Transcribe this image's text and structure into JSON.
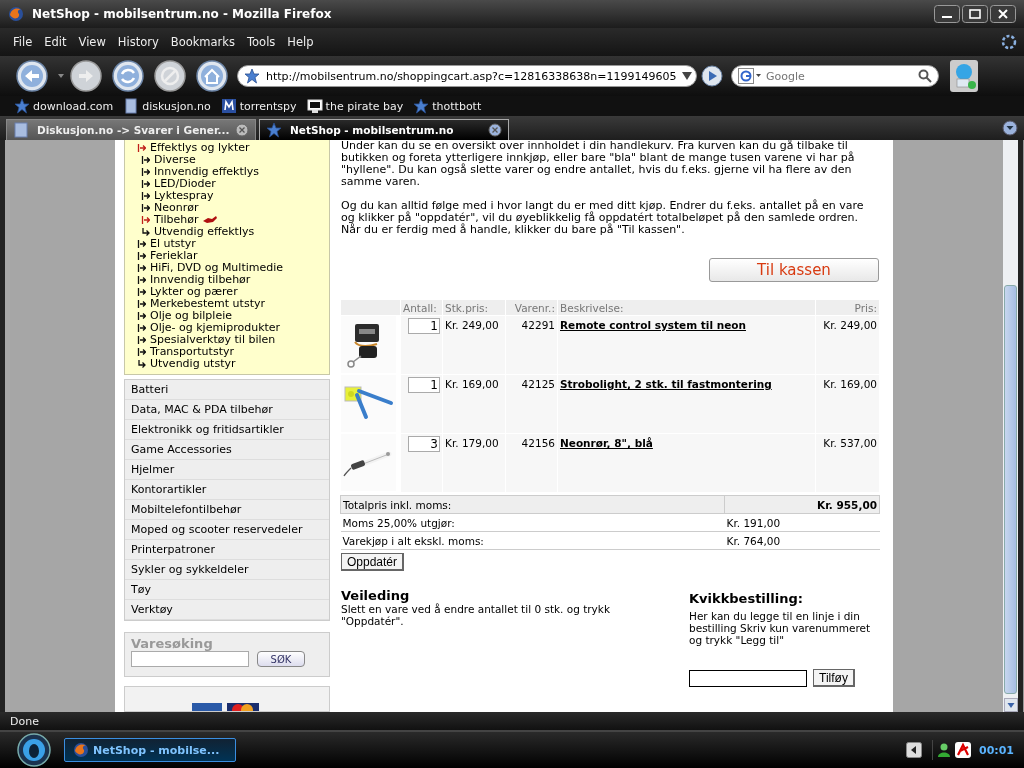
{
  "window": {
    "title": "NetShop - mobilsentrum.no - Mozilla Firefox"
  },
  "menu": [
    "File",
    "Edit",
    "View",
    "History",
    "Bookmarks",
    "Tools",
    "Help"
  ],
  "address_bar": {
    "url": "http://mobilsentrum.no/shoppingcart.asp?c=12816338638n=1199149605"
  },
  "search": {
    "placeholder": "Google"
  },
  "bookmarks": [
    "download.com",
    "diskusjon.no",
    "torrentspy",
    "the pirate bay",
    "thottbott"
  ],
  "tabs": [
    {
      "label": "Diskusjon.no -> Svarer i Gener...",
      "selected": false
    },
    {
      "label": "NetShop - mobilsentrum.no",
      "selected": true
    }
  ],
  "sidebar": {
    "tree": [
      {
        "label": "Effektlys og lykter",
        "selected": true,
        "children": [
          {
            "label": "Diverse",
            "selected": false
          },
          {
            "label": "Innvendig effektlys",
            "selected": false
          },
          {
            "label": "LED/Dioder",
            "selected": false
          },
          {
            "label": "Lyktespray",
            "selected": false
          },
          {
            "label": "Neonrør",
            "selected": false
          },
          {
            "label": "Tilbehør",
            "selected": true
          },
          {
            "label": "Utvendig effektlys",
            "selected": false
          }
        ]
      },
      {
        "label": "El utstyr",
        "selected": false
      },
      {
        "label": "Ferieklar",
        "selected": false
      },
      {
        "label": "HiFi, DVD og Multimedie",
        "selected": false
      },
      {
        "label": "Innvendig tilbehør",
        "selected": false
      },
      {
        "label": "Lykter og pærer",
        "selected": false
      },
      {
        "label": "Merkebestemt utstyr",
        "selected": false
      },
      {
        "label": "Olje og bilpleie",
        "selected": false
      },
      {
        "label": "Olje- og kjemiprodukter",
        "selected": false
      },
      {
        "label": "Spesialverktøy til bilen",
        "selected": false
      },
      {
        "label": "Transportutstyr",
        "selected": false
      },
      {
        "label": "Utvendig utstyr",
        "selected": false
      }
    ],
    "categories": [
      "Batteri",
      "Data, MAC & PDA tilbehør",
      "Elektronikk og fritidsartikler",
      "Game Accessories",
      "Hjelmer",
      "Kontorartikler",
      "Mobiltelefontilbehør",
      "Moped og scooter reservedeler",
      "Printerpatroner",
      "Sykler og sykkeldeler",
      "Tøy",
      "Verktøy"
    ],
    "search": {
      "title": "Varesøking",
      "button": "SØK"
    }
  },
  "intro": [
    "Under kan du se en oversikt over innholdet i din handlekurv. Fra kurven kan du gå tilbake til butikken og foreta ytterligere innkjøp, eller bare \"bla\" blant de mange tusen varene vi har på \"hyllene\". Du kan også slette varer og endre antallet, hvis du f.eks. gjerne vil ha flere av den samme varen.",
    "Og du kan alltid følge med i hvor langt du er med ditt kjøp. Endrer du f.eks. antallet på en vare og klikker på \"oppdatér\", vil du øyeblikkelig få oppdatért totalbeløpet på den samlede ordren. Når du er ferdig med å handle, klikker du bare på \"Til kassen\"."
  ],
  "checkout_button": "Til kassen",
  "cart": {
    "columns": [
      "Antall:",
      "Stk.pris:",
      "Varenr.:",
      "Beskrivelse:",
      "Pris:"
    ],
    "rows": [
      {
        "quantity": "1",
        "unit_price": "Kr. 249,00",
        "item_no": "42291",
        "description": "Remote control system til neon",
        "price": "Kr. 249,00"
      },
      {
        "quantity": "1",
        "unit_price": "Kr. 169,00",
        "item_no": "42125",
        "description": "Strobolight, 2 stk. til fastmontering",
        "price": "Kr. 169,00"
      },
      {
        "quantity": "3",
        "unit_price": "Kr. 179,00",
        "item_no": "42156",
        "description": "Neonrør, 8\", blå",
        "price": "Kr. 537,00"
      }
    ],
    "totals": [
      {
        "kind": "total",
        "label": "Totalpris inkl. moms:",
        "value": "Kr. 955,00"
      },
      {
        "kind": "line",
        "label": "Moms 25,00% utgjør:",
        "value": "Kr. 191,00"
      },
      {
        "kind": "line",
        "label": "Varekjøp i alt ekskl. moms:",
        "value": "Kr. 764,00"
      }
    ]
  },
  "update_button": "Oppdatér",
  "guide": {
    "title": "Veileding",
    "text": "Slett en vare ved å endre antallet til 0 stk. og trykk \"Oppdatér\"."
  },
  "quick_order": {
    "title": "Kvikkbestilling:",
    "text": "Her kan du legge til en linje i din bestilling Skriv kun varenummeret og trykk \"Legg til\"",
    "button": "Tilføy"
  },
  "status_bar": "Done",
  "taskbar": {
    "task": "NetShop - mobilse...",
    "clock": "00:01"
  }
}
